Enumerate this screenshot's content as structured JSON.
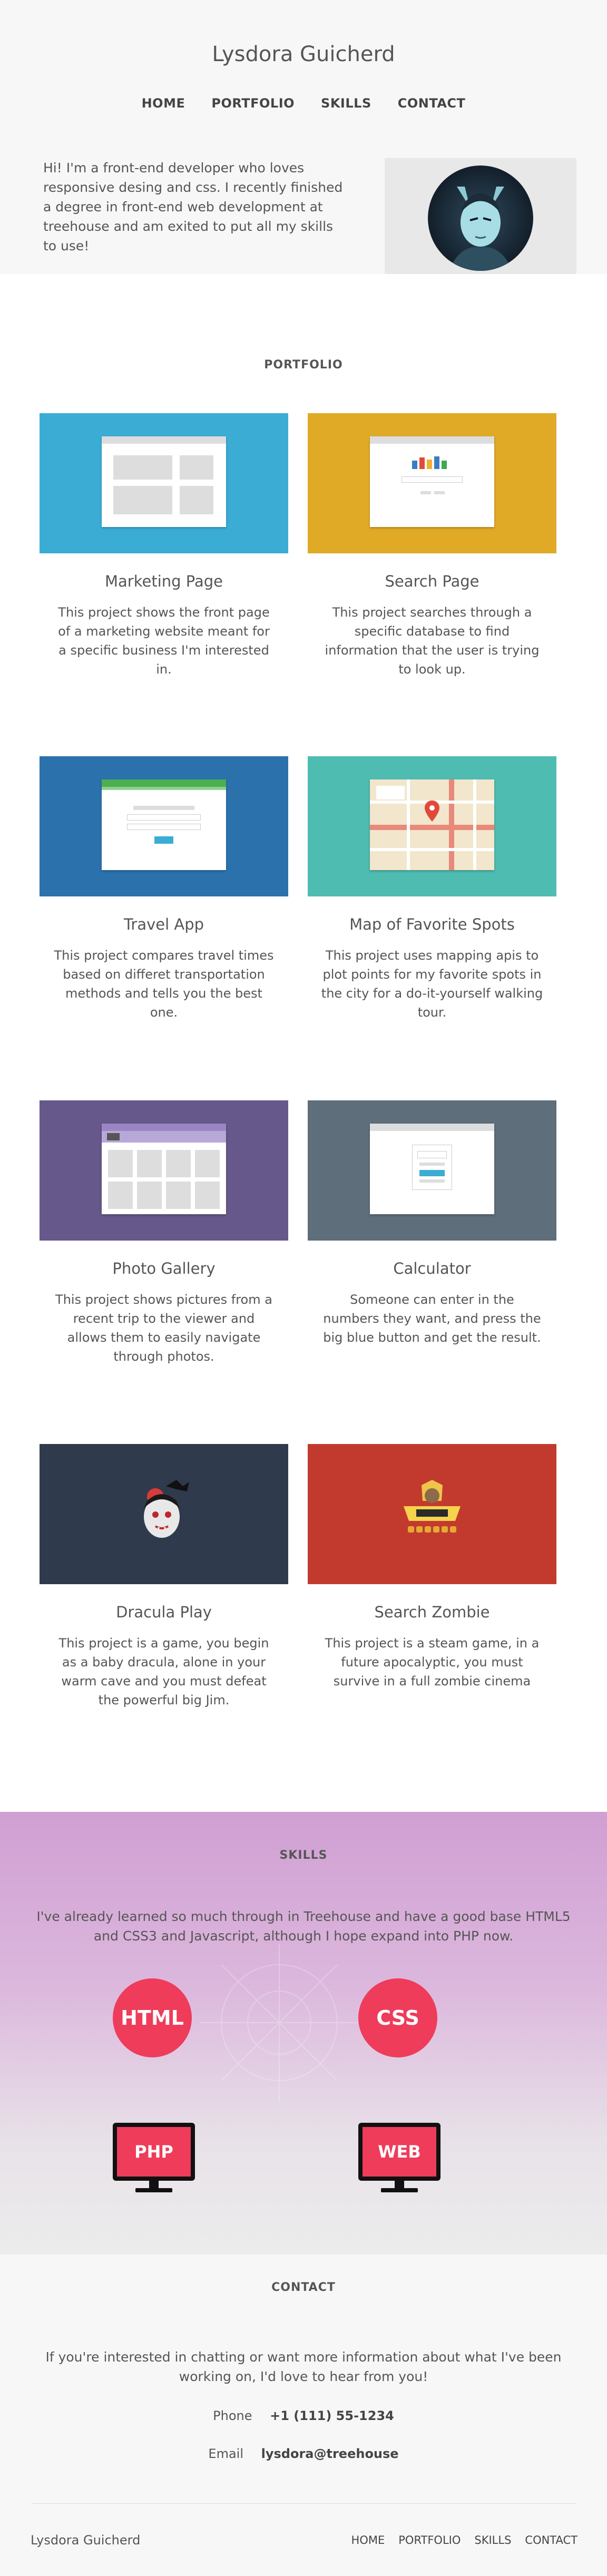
{
  "header": {
    "site_title": "Lysdora Guicherd",
    "nav": [
      "HOME",
      "PORTFOLIO",
      "SKILLS",
      "CONTACT"
    ],
    "intro": "Hi! I'm a front-end developer who loves responsive desing and css. I recently finished a degree in front-end web development at treehouse and am exited to put all my skills to use!"
  },
  "portfolio": {
    "heading": "PORTFOLIO",
    "projects": [
      {
        "title": "Marketing Page",
        "description": "This project shows the front page of a marketing website meant for a specific business I'm interested in.",
        "color": "#3badd4"
      },
      {
        "title": "Search Page",
        "description": "This project searches through a specific database to find information that the user is trying to look up.",
        "color": "#e0aa27"
      },
      {
        "title": "Travel App",
        "description": "This project compares travel times based on differet transportation methods and tells you the best one.",
        "color": "#2b72ad"
      },
      {
        "title": "Map of Favorite Spots",
        "description": "This project uses mapping apis to plot points for my favorite spots in the city for a do-it-yourself walking tour.",
        "color": "#4fbcb1"
      },
      {
        "title": "Photo Gallery",
        "description": "This project shows pictures from a recent trip to the viewer and allows them to easily navigate through photos.",
        "color": "#66588a"
      },
      {
        "title": "Calculator",
        "description": "Someone can enter in the numbers they want, and press the big blue button and get the result.",
        "color": "#5e6e7a"
      },
      {
        "title": "Dracula Play",
        "description": "This project is a game, you begin as a baby dracula, alone in your warm cave and you must defeat the powerful big Jim.",
        "color": "#2f3a4d"
      },
      {
        "title": "Search Zombie",
        "description": "This project is a steam game, in a future apocalyptic, you must survive in a full zombie cinema",
        "color": "#c23a2e"
      }
    ]
  },
  "skills": {
    "heading": "SKILLS",
    "text": "I've already learned so much through in Treehouse and have a good base HTML5 and CSS3 and Javascript, although I hope expand into PHP now.",
    "badges": [
      "HTML",
      "CSS",
      "PHP",
      "WEB"
    ],
    "accent": "#ee3c5a"
  },
  "contact": {
    "heading": "CONTACT",
    "text": "If you're interested in chatting or want more information about what I've been working on, I'd love to hear from you!",
    "phone_label": "Phone",
    "phone": "+1 (111) 55-1234",
    "email_label": "Email",
    "email": "lysdora@treehouse"
  },
  "footer": {
    "name": "Lysdora Guicherd",
    "nav": [
      "HOME",
      "PORTFOLIO",
      "SKILLS",
      "CONTACT"
    ]
  }
}
